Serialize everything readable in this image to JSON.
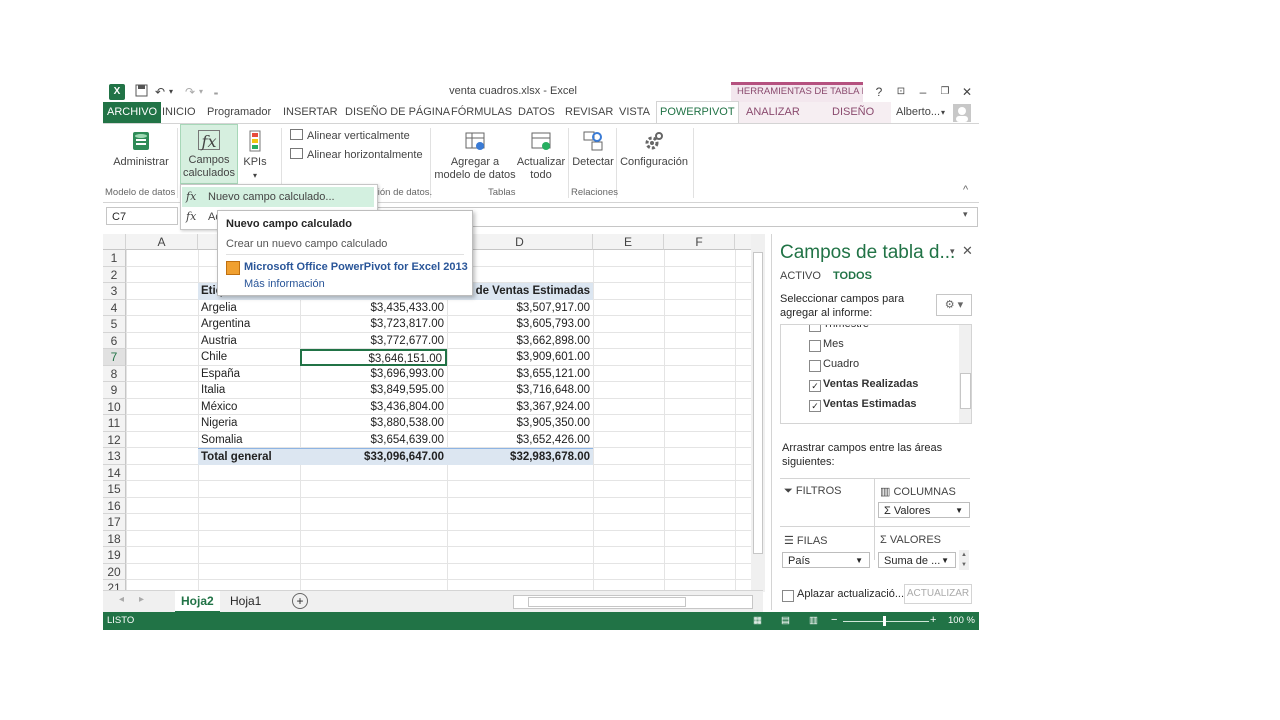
{
  "window": {
    "title": "venta cuadros.xlsx - Excel",
    "context_tab_group": "HERRAMIENTAS DE TABLA DI...",
    "help": "?",
    "user": "Alberto...",
    "caret": "▾"
  },
  "quick_access": {
    "undo_glyph": "↶",
    "redo_glyph": "↷",
    "customize_glyph": "₌"
  },
  "tabs": [
    {
      "label": "ARCHIVO"
    },
    {
      "label": "INICIO"
    },
    {
      "label": "Programador"
    },
    {
      "label": "INSERTAR"
    },
    {
      "label": "DISEÑO DE PÁGINA"
    },
    {
      "label": "FÓRMULAS"
    },
    {
      "label": "DATOS"
    },
    {
      "label": "REVISAR"
    },
    {
      "label": "VISTA"
    },
    {
      "label": "POWERPIVOT"
    },
    {
      "label": "ANALIZAR"
    },
    {
      "label": "DISEÑO"
    }
  ],
  "ribbon": {
    "administrar": "Administrar",
    "campos_1": "Campos",
    "campos_2": "calculados",
    "kpis": "KPIs",
    "alinear_v": "Alinear verticalmente",
    "alinear_h": "Alinear horizontalmente",
    "agregar_1": "Agregar a",
    "agregar_2": "modelo de datos",
    "actualizar_1": "Actualizar",
    "actualizar_2": "todo",
    "detectar": "Detectar",
    "configuracion": "Configuración",
    "group_modelo": "Modelo de datos",
    "group_alineacion": "ción de datos.",
    "group_tablas": "Tablas",
    "group_relaciones": "Relaciones",
    "collapse": "^"
  },
  "dropdown_menu": {
    "item1": "Nuevo campo calculado...",
    "item2": "Ac"
  },
  "tooltip": {
    "title": "Nuevo campo calculado",
    "desc": "Crear un nuevo campo calculado",
    "link_title": "Microsoft Office PowerPivot for Excel 2013",
    "link_more": "Más información"
  },
  "formula_bar": {
    "name_box": "C7"
  },
  "sheet": {
    "columns": [
      "A",
      "D",
      "E",
      "F"
    ],
    "rows": [
      "1",
      "2",
      "3",
      "4",
      "5",
      "6",
      "7",
      "8",
      "9",
      "10",
      "11",
      "12",
      "13",
      "14",
      "15",
      "16",
      "17",
      "18",
      "19",
      "20",
      "21"
    ],
    "header_b": "Etiq",
    "header_d": "na de Ventas Estimadas",
    "data": [
      {
        "pais": "Argelia",
        "real": "$3,435,433.00",
        "est": "$3,507,917.00"
      },
      {
        "pais": "Argentina",
        "real": "$3,723,817.00",
        "est": "$3,605,793.00"
      },
      {
        "pais": "Austria",
        "real": "$3,772,677.00",
        "est": "$3,662,898.00"
      },
      {
        "pais": "Chile",
        "real": "$3,646,151.00",
        "est": "$3,909,601.00"
      },
      {
        "pais": "España",
        "real": "$3,696,993.00",
        "est": "$3,655,121.00"
      },
      {
        "pais": "Italia",
        "real": "$3,849,595.00",
        "est": "$3,716,648.00"
      },
      {
        "pais": "México",
        "real": "$3,436,804.00",
        "est": "$3,367,924.00"
      },
      {
        "pais": "Nigeria",
        "real": "$3,880,538.00",
        "est": "$3,905,350.00"
      },
      {
        "pais": "Somalia",
        "real": "$3,654,639.00",
        "est": "$3,652,426.00"
      }
    ],
    "total": {
      "label": "Total general",
      "real": "$33,096,647.00",
      "est": "$32,983,678.00"
    }
  },
  "sheet_tabs": [
    {
      "label": "Hoja2"
    },
    {
      "label": "Hoja1"
    }
  ],
  "status": {
    "ready": "LISTO",
    "zoom": "100 %",
    "minus": "−",
    "plus": "+"
  },
  "pivot_pane": {
    "title": "Campos de tabla d...",
    "tab_activo": "ACTIVO",
    "tab_todos": "TODOS",
    "select_1": "Seleccionar campos para",
    "select_2": "agregar al informe:",
    "fields": [
      {
        "label": "Trimestre",
        "checked": false
      },
      {
        "label": "Mes",
        "checked": false
      },
      {
        "label": "Cuadro",
        "checked": false
      },
      {
        "label": "Ventas Realizadas",
        "checked": true
      },
      {
        "label": "Ventas Estimadas",
        "checked": true
      }
    ],
    "drag_1": "Arrastrar campos entre las áreas",
    "drag_2": "siguientes:",
    "filtros": "FILTROS",
    "columnas": "COLUMNAS",
    "filas": "FILAS",
    "valores": "VALORES",
    "col_value": "Σ Valores",
    "row_value": "País",
    "val_value": "Suma de ...",
    "defer": "Aplazar actualizació...",
    "update": "ACTUALIZAR"
  },
  "colors": {
    "excel_green": "#217346",
    "table_blue": "#dce6f1",
    "context_pink": "#b5517f"
  }
}
